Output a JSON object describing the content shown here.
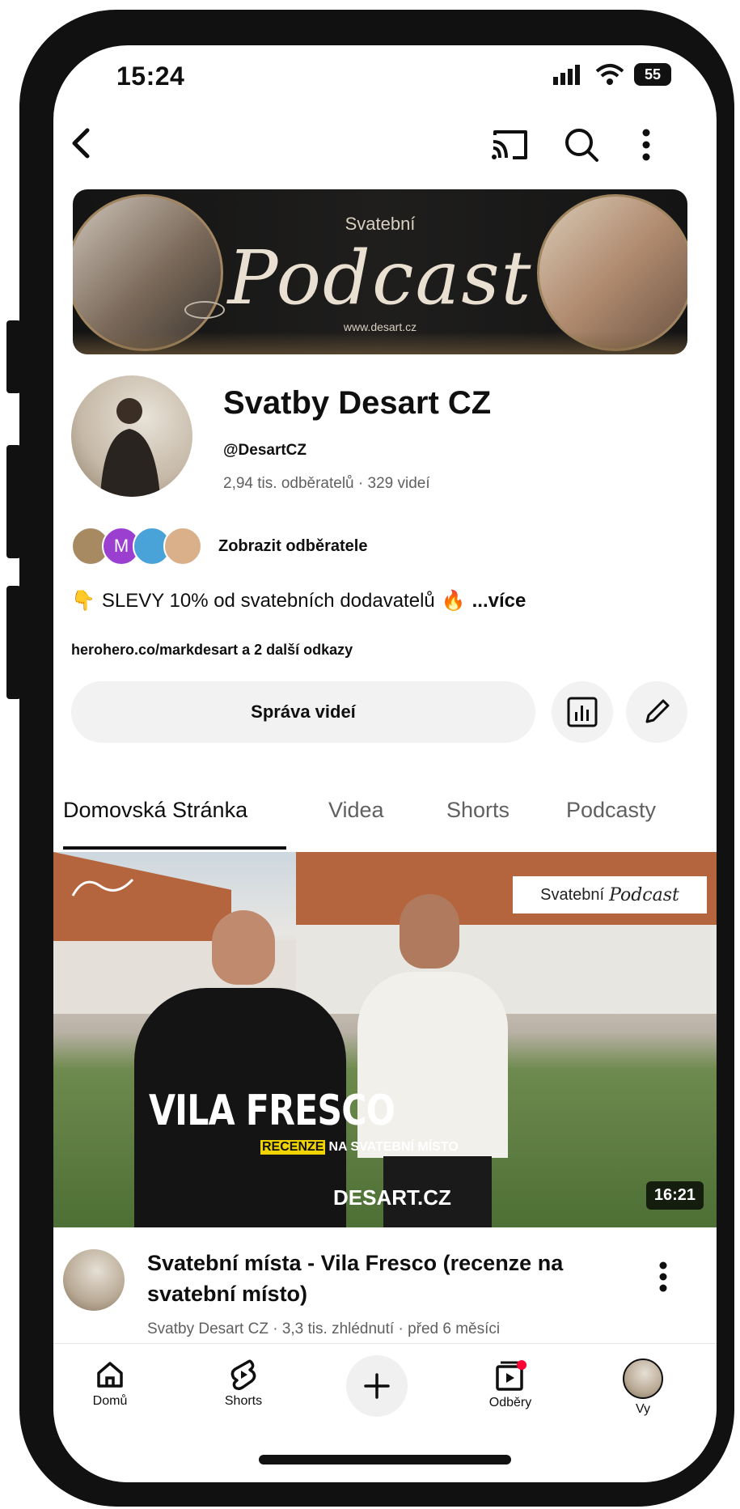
{
  "status_bar": {
    "time": "15:24",
    "battery": "55"
  },
  "banner": {
    "small_text": "Svatební",
    "script_text": "Podcast",
    "url_text": "www.desart.cz"
  },
  "channel": {
    "name": "Svatby Desart CZ",
    "handle": "@DesartCZ",
    "stats": "2,94 tis. odběratelů · 329 videí",
    "subscribers_label": "Zobrazit odběratele",
    "subscriber_badge_letter": "M",
    "description": "SLEVY 10% od svatebních dodavatelů",
    "description_more": "...více",
    "links": "herohero.co/markdesart a 2 další odkazy",
    "manage_button": "Správa videí"
  },
  "tabs": [
    {
      "label": "Domovská Stránka",
      "active": true
    },
    {
      "label": "Videa",
      "active": false
    },
    {
      "label": "Shorts",
      "active": false
    },
    {
      "label": "Podcasty",
      "active": false
    }
  ],
  "featured_video": {
    "thumb_badge_a": "Svatební",
    "thumb_badge_b": "Podcast",
    "thumb_title": "VILA FRESCO",
    "thumb_subtitle_a": "RECENZE",
    "thumb_subtitle_b": "NA SVATEBNÍ MÍSTO",
    "thumb_site": "DESART.CZ",
    "duration": "16:21",
    "title": "Svatební místa - Vila Fresco (recenze na svatební místo)",
    "meta": "Svatby Desart CZ · 3,3 tis. zhlédnutí · před 6 měsíci"
  },
  "bottom_nav": [
    {
      "label": "Domů"
    },
    {
      "label": "Shorts"
    },
    {
      "label": "Odběry"
    },
    {
      "label": "Vy"
    }
  ],
  "colors": {
    "text": "#0f0f0f",
    "secondary": "#606060",
    "chip": "#f2f2f2",
    "notify": "#ff0033"
  }
}
